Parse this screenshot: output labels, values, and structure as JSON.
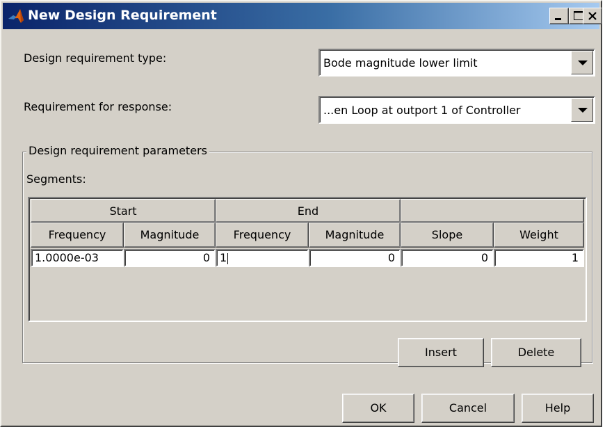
{
  "window": {
    "title": "New Design Requirement",
    "controls": {
      "minimize_icon": "minimize-icon",
      "maximize_icon": "maximize-icon",
      "close_icon": "close-icon"
    }
  },
  "form": {
    "type_label": "Design requirement type:",
    "type_value": "Bode magnitude lower limit",
    "response_label": "Requirement for response:",
    "response_value": "...en Loop at outport 1 of Controller"
  },
  "parameters": {
    "group_label": "Design requirement parameters",
    "segments_label": "Segments:",
    "table": {
      "group_headers": [
        "Start",
        "End",
        ""
      ],
      "column_headers": [
        "Frequency",
        "Magnitude",
        "Frequency",
        "Magnitude",
        "Slope",
        "Weight"
      ],
      "rows": [
        [
          "1.0000e-03",
          "0",
          "1",
          "0",
          "0",
          "1"
        ]
      ]
    },
    "insert_label": "Insert",
    "delete_label": "Delete"
  },
  "footer": {
    "ok_label": "OK",
    "cancel_label": "Cancel",
    "help_label": "Help"
  },
  "colors": {
    "title_gradient_start": "#0a246a",
    "title_gradient_end": "#a6caf0",
    "dialog_bg": "#d4d0c8"
  }
}
